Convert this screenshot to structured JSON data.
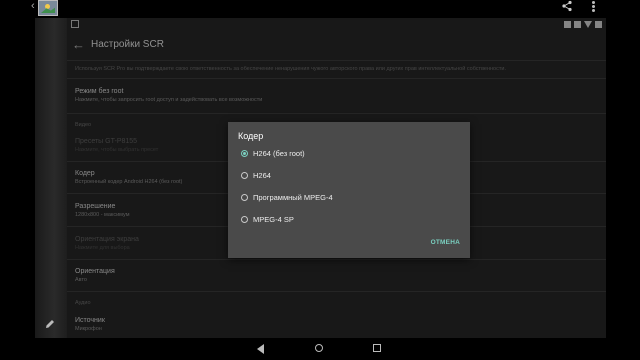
{
  "app": {
    "title": "Настройки SCR"
  },
  "disclaimer": "Используя SCR Pro вы подтверждаете свою ответственность за обеспечение ненарушения чужого авторского права или других прав интеллектуальной собственности.",
  "preferences": {
    "rootless": {
      "title": "Режим без root",
      "summary": "Нажмите, чтобы запросить root доступ и задействовать все возможности"
    },
    "video_header": "Видео",
    "preset": {
      "title": "Пресеты GT-P8155",
      "summary": "Нажмите, чтобы выбрать пресет"
    },
    "encoder": {
      "title": "Кодер",
      "summary": "Встроенный кодер Android H264 (без root)"
    },
    "resolution": {
      "title": "Разрешение",
      "summary": "1280x800 - максимум"
    },
    "orientation_lock": {
      "title": "Ориентация экрана",
      "summary": "Нажмите для выбора"
    },
    "orientation": {
      "title": "Ориентация",
      "summary": "Авто"
    },
    "audio_header": "Аудио",
    "source": {
      "title": "Источник",
      "summary": "Микрофон"
    }
  },
  "dialog": {
    "title": "Кодер",
    "options": [
      {
        "label": "H264 (без root)",
        "selected": true
      },
      {
        "label": "H264",
        "selected": false
      },
      {
        "label": "Программный MPEG-4",
        "selected": false
      },
      {
        "label": "MPEG-4 SP",
        "selected": false
      }
    ],
    "cancel": "ОТМЕНА"
  },
  "icons": {
    "back": "arrow-left-icon",
    "share": "share-icon",
    "more": "more-vert-icon",
    "edit": "pencil-icon",
    "nav_back": "nav-back-icon",
    "nav_home": "nav-home-icon",
    "nav_recents": "nav-recents-icon"
  },
  "colors": {
    "accent": "#7ad0c0",
    "dialog_bg": "#4a4a4a",
    "screen_bg": "#262626"
  }
}
